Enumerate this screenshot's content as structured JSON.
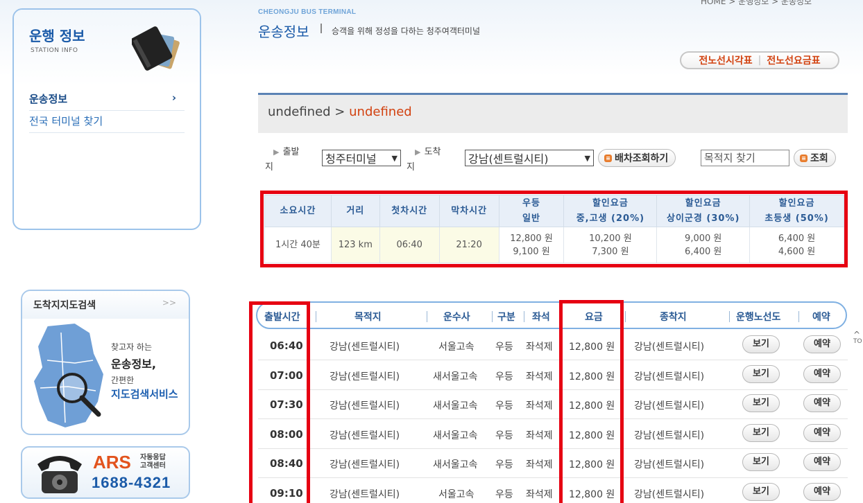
{
  "sidebar": {
    "title": "운행 정보",
    "subtitle": "STATION INFO",
    "items": [
      {
        "label": "운송정보",
        "arrow": "›"
      },
      {
        "label": "전국 터미널 찾기"
      }
    ]
  },
  "map_banner": {
    "title": "도착지지도검색",
    "chevron": ">>",
    "line1": "찾고자 하는",
    "line2": "운송정보,",
    "line3": "간편한",
    "line4": "지도검색서비스"
  },
  "ars_banner": {
    "brand": "ARS",
    "small1": "자동응답",
    "small2": "고객센터",
    "number": "1688-4321"
  },
  "header": {
    "terminal": "CHEONGJU BUS TERMINAL",
    "title": "운송정보",
    "desc": "승객을 위해 정성을 다하는 청주여객터미널",
    "top_crumb": "HOME > 운행정보 > 운송정보",
    "btn_timetable": "전노선시각표",
    "btn_fare": "전노선요금표"
  },
  "section": {
    "crumb_root": "undefined",
    "crumb_sep": ">",
    "crumb_current": "undefined"
  },
  "search": {
    "depart_label": "출발",
    "depart_label2": "지",
    "depart_value": "청주터미널",
    "arrive_label": "도착",
    "arrive_label2": "지",
    "arrive_value": "강남(센트럴시티)",
    "btn_schedule": "배차조회하기",
    "dest_placeholder": "목적지 찾기",
    "btn_search": "조회"
  },
  "fare_table": {
    "headers": [
      [
        "소요시간"
      ],
      [
        "거리"
      ],
      [
        "첫차시간"
      ],
      [
        "막차시간"
      ],
      [
        "우등",
        "일반"
      ],
      [
        "할인요금",
        "중,고생 (20%)"
      ],
      [
        "할인요금",
        "상이군경 (30%)"
      ],
      [
        "할인요금",
        "초등생 (50%)"
      ]
    ],
    "row": {
      "duration": "1시간 40분",
      "distance": "123 km",
      "first": "06:40",
      "last": "21:20",
      "fare_premium": "12,800 원",
      "fare_normal": "9,100 원",
      "student_premium": "10,200 원",
      "student_normal": "7,300 원",
      "veteran_premium": "9,000 원",
      "veteran_normal": "6,400 원",
      "child_premium": "6,400 원",
      "child_normal": "4,600 원"
    }
  },
  "schedule": {
    "headers": {
      "time": "출발시간",
      "dest": "목적지",
      "company": "운수사",
      "class": "구분",
      "seat": "좌석",
      "fare": "요금",
      "terminus": "종착지",
      "route_map": "운행노선도",
      "reserve": "예약"
    },
    "rows": [
      {
        "time": "06:40",
        "dest": "강남(센트럴시티)",
        "company": "서울고속",
        "class": "우등",
        "seat": "좌석제",
        "fare": "12,800 원",
        "terminus": "강남(센트럴시티)",
        "view": "보기",
        "reserve": "예약"
      },
      {
        "time": "07:00",
        "dest": "강남(센트럴시티)",
        "company": "새서울고속",
        "class": "우등",
        "seat": "좌석제",
        "fare": "12,800 원",
        "terminus": "강남(센트럴시티)",
        "view": "보기",
        "reserve": "예약"
      },
      {
        "time": "07:30",
        "dest": "강남(센트럴시티)",
        "company": "새서울고속",
        "class": "우등",
        "seat": "좌석제",
        "fare": "12,800 원",
        "terminus": "강남(센트럴시티)",
        "view": "보기",
        "reserve": "예약"
      },
      {
        "time": "08:00",
        "dest": "강남(센트럴시티)",
        "company": "새서울고속",
        "class": "우등",
        "seat": "좌석제",
        "fare": "12,800 원",
        "terminus": "강남(센트럴시티)",
        "view": "보기",
        "reserve": "예약"
      },
      {
        "time": "08:40",
        "dest": "강남(센트럴시티)",
        "company": "새서울고속",
        "class": "우등",
        "seat": "좌석제",
        "fare": "12,800 원",
        "terminus": "강남(센트럴시티)",
        "view": "보기",
        "reserve": "예약"
      },
      {
        "time": "09:10",
        "dest": "강남(센트럴시티)",
        "company": "서울고속",
        "class": "우등",
        "seat": "좌석제",
        "fare": "12,800 원",
        "terminus": "강남(센트럴시티)",
        "view": "보기",
        "reserve": "예약"
      }
    ],
    "to_top": "TO"
  },
  "colors": {
    "brand_blue": "#1a5aa8",
    "accent_orange": "#d2410f",
    "highlight_red": "#e60012"
  }
}
